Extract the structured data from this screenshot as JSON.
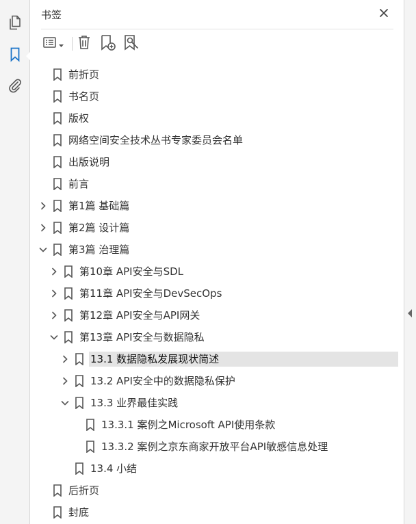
{
  "rail": {
    "items": [
      {
        "name": "pages-thumbnails",
        "icon": "pages-icon"
      },
      {
        "name": "bookmarks",
        "icon": "bookmark-icon",
        "active": true
      },
      {
        "name": "attachments",
        "icon": "paperclip-icon"
      }
    ]
  },
  "panel": {
    "title": "书签",
    "close_icon": "close-icon"
  },
  "toolbar": {
    "icons": [
      "options-menu-icon",
      "chevron-down-icon",
      "delete-icon",
      "new-bookmark-icon",
      "find-bookmark-icon"
    ]
  },
  "bookmarks": [
    {
      "label": "前折页",
      "level": 0,
      "toggle": "none"
    },
    {
      "label": "书名页",
      "level": 0,
      "toggle": "none"
    },
    {
      "label": "版权",
      "level": 0,
      "toggle": "none"
    },
    {
      "label": "网络空间安全技术丛书专家委员会名单",
      "level": 0,
      "toggle": "none"
    },
    {
      "label": "出版说明",
      "level": 0,
      "toggle": "none"
    },
    {
      "label": "前言",
      "level": 0,
      "toggle": "none"
    },
    {
      "label": "第1篇 基础篇",
      "level": 0,
      "toggle": "collapsed"
    },
    {
      "label": "第2篇 设计篇",
      "level": 0,
      "toggle": "collapsed"
    },
    {
      "label": "第3篇 治理篇",
      "level": 0,
      "toggle": "expanded"
    },
    {
      "label": "第10章 API安全与SDL",
      "level": 1,
      "toggle": "collapsed"
    },
    {
      "label": "第11章 API安全与DevSecOps",
      "level": 1,
      "toggle": "collapsed"
    },
    {
      "label": "第12章 API安全与API网关",
      "level": 1,
      "toggle": "collapsed"
    },
    {
      "label": "第13章 API安全与数据隐私",
      "level": 1,
      "toggle": "expanded"
    },
    {
      "label": "13.1 数据隐私发展现状简述",
      "level": 2,
      "toggle": "collapsed",
      "selected": true
    },
    {
      "label": "13.2 API安全中的数据隐私保护",
      "level": 2,
      "toggle": "collapsed"
    },
    {
      "label": "13.3 业界最佳实践",
      "level": 2,
      "toggle": "expanded"
    },
    {
      "label": "13.3.1 案例之Microsoft API使用条款",
      "level": 3,
      "toggle": "none"
    },
    {
      "label": "13.3.2 案例之京东商家开放平台API敏感信息处理",
      "level": 3,
      "toggle": "none"
    },
    {
      "label": "13.4 小结",
      "level": 2,
      "toggle": "none"
    },
    {
      "label": "后折页",
      "level": 0,
      "toggle": "none"
    },
    {
      "label": "封底",
      "level": 0,
      "toggle": "none"
    }
  ],
  "colors": {
    "accent": "#1a73c8",
    "icon": "#555555",
    "selected_bg": "#e4e4e4"
  }
}
